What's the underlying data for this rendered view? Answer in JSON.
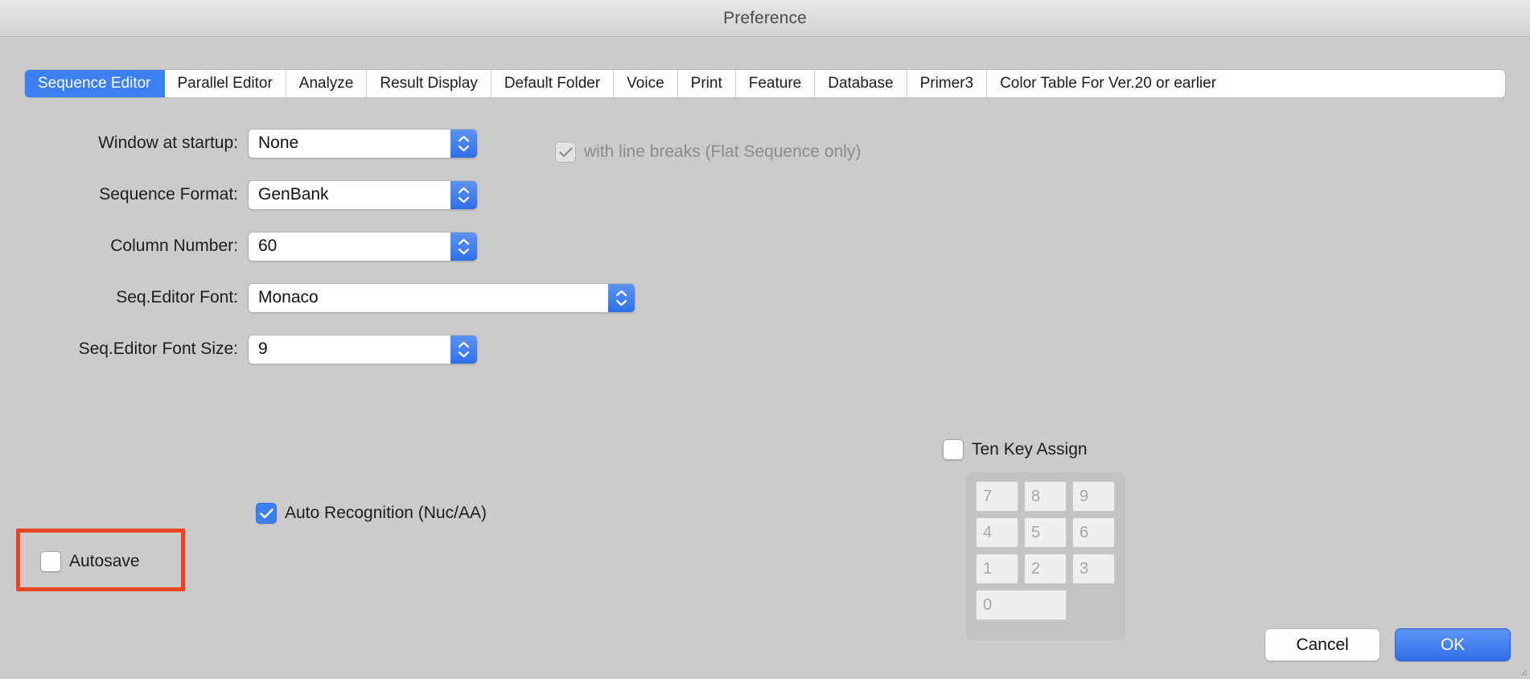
{
  "window": {
    "title": "Preference"
  },
  "tabs": [
    {
      "label": "Sequence Editor",
      "active": true
    },
    {
      "label": "Parallel Editor",
      "active": false
    },
    {
      "label": "Analyze",
      "active": false
    },
    {
      "label": "Result Display",
      "active": false
    },
    {
      "label": "Default Folder",
      "active": false
    },
    {
      "label": "Voice",
      "active": false
    },
    {
      "label": "Print",
      "active": false
    },
    {
      "label": "Feature",
      "active": false
    },
    {
      "label": "Database",
      "active": false
    },
    {
      "label": "Primer3",
      "active": false
    },
    {
      "label": "Color Table For Ver.20 or earlier",
      "active": false
    }
  ],
  "form": {
    "window_at_startup": {
      "label": "Window at startup:",
      "value": "None"
    },
    "sequence_format": {
      "label": "Sequence Format:",
      "value": "GenBank"
    },
    "column_number": {
      "label": "Column Number:",
      "value": "60"
    },
    "seq_editor_font": {
      "label": "Seq.Editor Font:",
      "value": "Monaco"
    },
    "seq_editor_font_size": {
      "label": "Seq.Editor Font Size:",
      "value": "9"
    }
  },
  "checkboxes": {
    "with_line_breaks": {
      "label": "with line breaks (Flat Sequence only)",
      "checked": true,
      "disabled": true
    },
    "auto_recognition": {
      "label": "Auto Recognition (Nuc/AA)",
      "checked": true,
      "disabled": false
    },
    "autosave": {
      "label": "Autosave",
      "checked": false,
      "disabled": false
    },
    "ten_key_assign": {
      "label": "Ten Key Assign",
      "checked": false,
      "disabled": false
    }
  },
  "ten_key_pad": {
    "rows": [
      [
        "7",
        "8",
        "9"
      ],
      [
        "4",
        "5",
        "6"
      ],
      [
        "1",
        "2",
        "3"
      ]
    ],
    "zero": "0"
  },
  "footer": {
    "cancel_label": "Cancel",
    "ok_label": "OK"
  },
  "annotation": {
    "target": "autosave",
    "color": "#e8441f"
  },
  "colors": {
    "accent": "#3b7ff2",
    "window_background": "#cbcbcb",
    "titlebar_background": "#dcdcdc",
    "annotation_red": "#e8441f"
  }
}
